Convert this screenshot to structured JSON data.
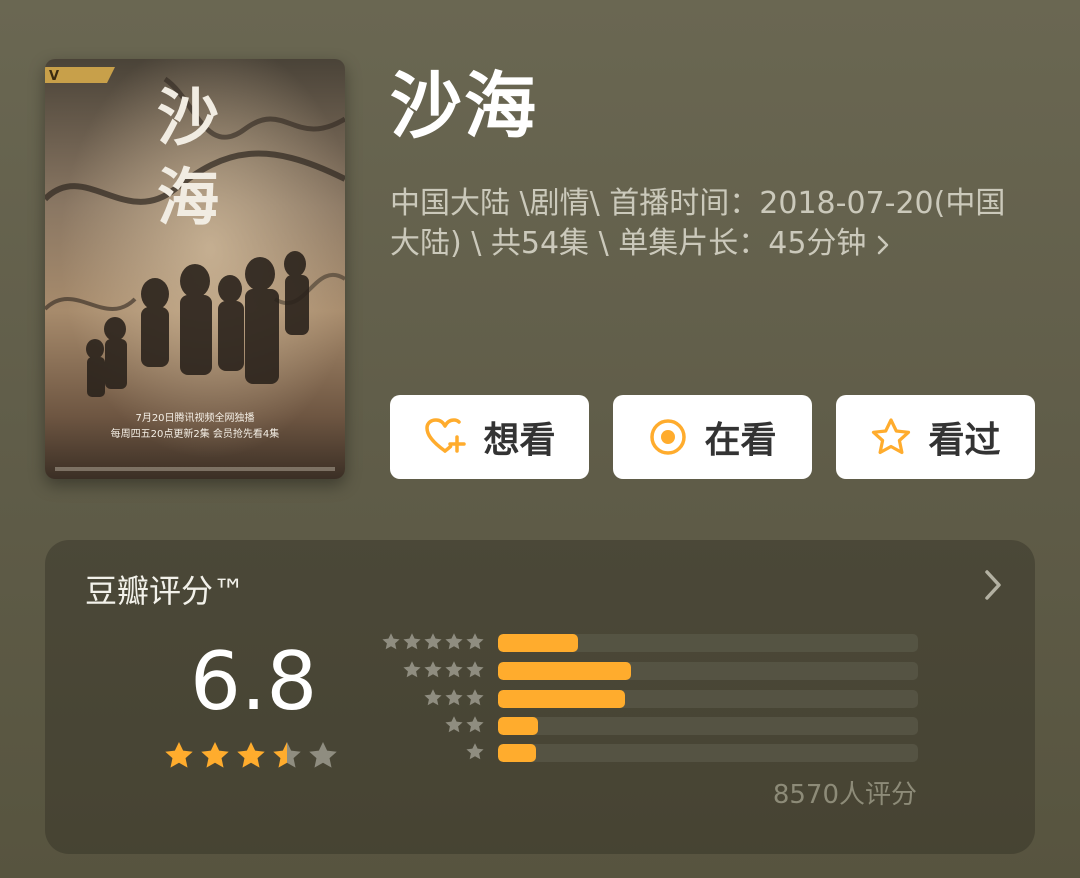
{
  "title": "沙海",
  "meta_text": "中国大陆 \\剧情\\ 首播时间：2018-07-20(中国大陆) \\ 共54集 \\ 单集片长：45分钟",
  "poster": {
    "title_chars": [
      "沙",
      "海"
    ],
    "badge": "V",
    "caption_line1": "7月20日腾讯视频全网独播",
    "caption_line2": "每周四五20点更新2集 会员抢先看4集"
  },
  "actions": [
    {
      "label": "想看",
      "icon": "heart-plus-icon"
    },
    {
      "label": "在看",
      "icon": "target-circle-icon"
    },
    {
      "label": "看过",
      "icon": "star-outline-icon"
    }
  ],
  "rating": {
    "title": "豆瓣评分™",
    "score": "6.8",
    "score_stars": 3.5,
    "votes_label": "8570人评分",
    "distribution": [
      {
        "stars": 5,
        "fraction": 0.19
      },
      {
        "stars": 4,
        "fraction": 0.317
      },
      {
        "stars": 3,
        "fraction": 0.302
      },
      {
        "stars": 2,
        "fraction": 0.095
      },
      {
        "stars": 1,
        "fraction": 0.09
      }
    ]
  },
  "colors": {
    "accent": "#ffac2d",
    "background": "#67644f",
    "button_bg": "#ffffff",
    "inactive_star": "#8f8d80"
  }
}
